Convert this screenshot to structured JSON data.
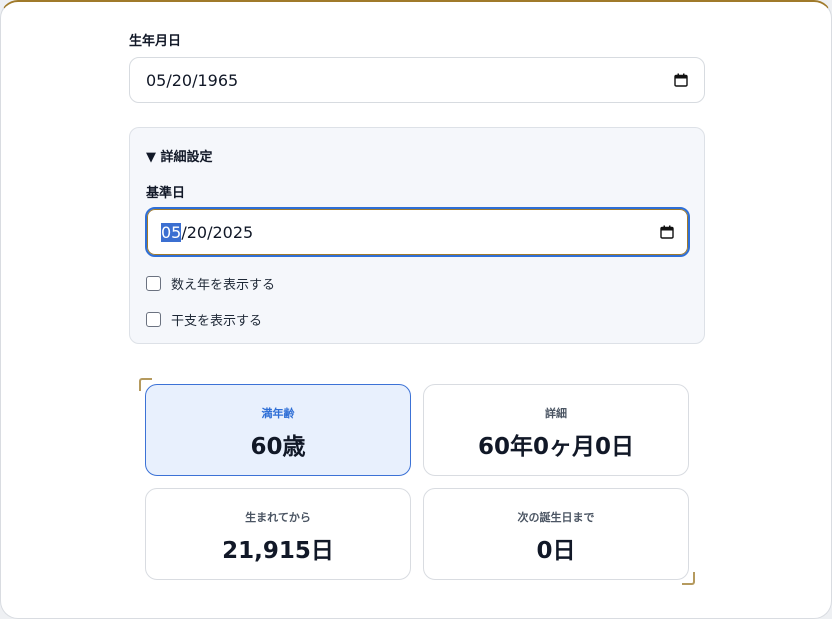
{
  "birth": {
    "label": "生年月日",
    "value": "05/20/1965"
  },
  "details": {
    "summary": "▼ 詳細設定",
    "base_label": "基準日",
    "base_value_selected": "05",
    "base_value_rest": "/20/2025",
    "options": [
      {
        "label": "数え年を表示する",
        "checked": false
      },
      {
        "label": "干支を表示する",
        "checked": false
      }
    ]
  },
  "results": [
    {
      "title": "満年齢",
      "value": "60歳"
    },
    {
      "title": "詳細",
      "value": "60年0ヶ月0日"
    },
    {
      "title": "生まれてから",
      "value": "21,915日"
    },
    {
      "title": "次の誕生日まで",
      "value": "0日"
    }
  ],
  "colors": {
    "accent": "#2f6fd6",
    "gold": "#a07a2a",
    "panel": "#f5f7fb"
  },
  "icons": {
    "calendar": "calendar-icon"
  }
}
